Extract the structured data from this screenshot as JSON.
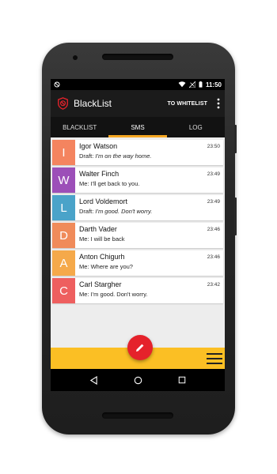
{
  "status_bar": {
    "time": "11:50"
  },
  "toolbar": {
    "title": "BlackList",
    "action_label": "TO WHITELIST"
  },
  "tabs": [
    {
      "label": "BLACKLIST",
      "active": false
    },
    {
      "label": "SMS",
      "active": true
    },
    {
      "label": "LOG",
      "active": false
    }
  ],
  "conversations": [
    {
      "initial": "I",
      "color": "#f4845f",
      "name": "Igor Watson",
      "time": "23:50",
      "prefix": "Draft: ",
      "text": "I'm on the way home.",
      "italic": true
    },
    {
      "initial": "W",
      "color": "#9c4fb8",
      "name": "Walter Finch",
      "time": "23:49",
      "prefix": "Me: ",
      "text": "I'll get back to you.",
      "italic": false
    },
    {
      "initial": "L",
      "color": "#4aa3c9",
      "name": "Lord Voldemort",
      "time": "23:49",
      "prefix": "Draft: ",
      "text": "I'm good. Don't worry.",
      "italic": true
    },
    {
      "initial": "D",
      "color": "#f08b5a",
      "name": "Darth Vader",
      "time": "23:46",
      "prefix": "Me: ",
      "text": "I will be back",
      "italic": false
    },
    {
      "initial": "A",
      "color": "#f5a94a",
      "name": "Anton Chigurh",
      "time": "23:46",
      "prefix": "Me: ",
      "text": "Where are you?",
      "italic": false
    },
    {
      "initial": "C",
      "color": "#ee5f5f",
      "name": "Carl Stargher",
      "time": "23:42",
      "prefix": "Me: ",
      "text": "I'm good. Don't worry.",
      "italic": false
    }
  ],
  "colors": {
    "accent": "#f5a623",
    "bottom_bar": "#fbbf24",
    "fab": "#e5222b",
    "toolbar": "#1b1b1b"
  },
  "icons": {
    "app": "blacklist-shield-icon",
    "fab": "pencil-icon",
    "menu": "hamburger-icon"
  }
}
